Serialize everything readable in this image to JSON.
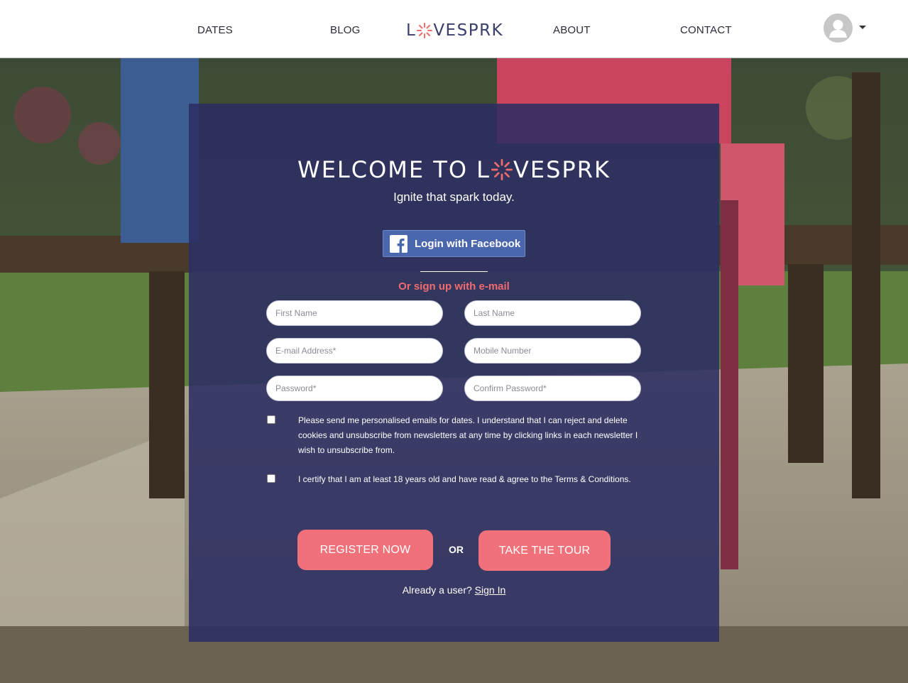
{
  "nav": {
    "dates": "DATES",
    "blog": "BLOG",
    "about": "ABOUT",
    "contact": "CONTACT",
    "logo_left": "L",
    "logo_right": "VESPRK"
  },
  "card": {
    "welcome_left": "WELCOME TO L",
    "welcome_right": "VESPRK",
    "tagline": "Ignite that spark today.",
    "facebook_label": "Login with Facebook",
    "or_email": "Or sign up with e-mail",
    "fields": {
      "first_name": "First Name",
      "last_name": "Last Name",
      "email": "E-mail Address*",
      "mobile": "Mobile Number",
      "password": "Password*",
      "confirm_password": "Confirm Password*"
    },
    "consent_emails": "Please send me personalised emails for dates. I understand that I can reject and delete cookies and unsubscribe from newsletters at any time by clicking links in each newsletter I wish to unsubscribe from.",
    "consent_age": "I certify that I am at least 18 years old and have read & agree to the Terms & Conditions.",
    "register_label": "REGISTER NOW",
    "or_label": "OR",
    "tour_label": "TAKE THE TOUR",
    "already_user": "Already a user?",
    "sign_in": "Sign In"
  },
  "colors": {
    "card_bg": "#2c2e62",
    "accent": "#f0717a",
    "facebook": "#4a66ad"
  },
  "icons": [
    "spark-icon",
    "facebook-icon",
    "user-avatar-icon",
    "caret-down-icon"
  ]
}
